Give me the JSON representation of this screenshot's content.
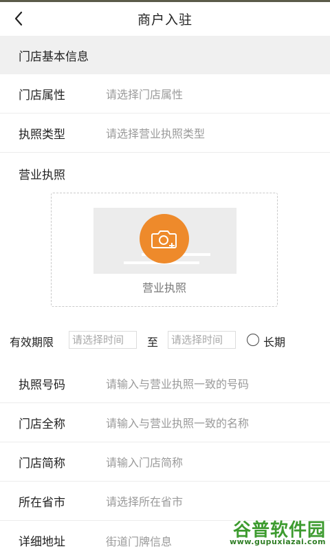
{
  "header": {
    "title": "商户入驻",
    "back_icon": "chevron-left-icon"
  },
  "section": {
    "title": "门店基本信息"
  },
  "fields": {
    "store_attribute": {
      "label": "门店属性",
      "placeholder": "请选择门店属性"
    },
    "license_type": {
      "label": "执照类型",
      "placeholder": "请选择营业执照类型"
    },
    "license_number": {
      "label": "执照号码",
      "placeholder": "请输入与营业执照一致的号码"
    },
    "store_full_name": {
      "label": "门店全称",
      "placeholder": "请输入与营业执照一致的名称"
    },
    "store_short_name": {
      "label": "门店简称",
      "placeholder": "请输入门店简称"
    },
    "province_city": {
      "label": "所在省市",
      "placeholder": "请选择所在省市"
    },
    "address": {
      "label": "详细地址",
      "placeholder": "街道门牌信息"
    }
  },
  "license_upload": {
    "label": "营业执照",
    "caption": "营业执照",
    "icon": "camera-add-icon",
    "accent_color": "#ee8a2b"
  },
  "validity": {
    "label": "有效期限",
    "start_placeholder": "请选择时间",
    "to": "至",
    "end_placeholder": "请选择时间",
    "long_term": "长期",
    "long_term_checked": false
  },
  "watermark": {
    "main": "谷普软件园",
    "url": "www.gupuxiazai.com"
  }
}
